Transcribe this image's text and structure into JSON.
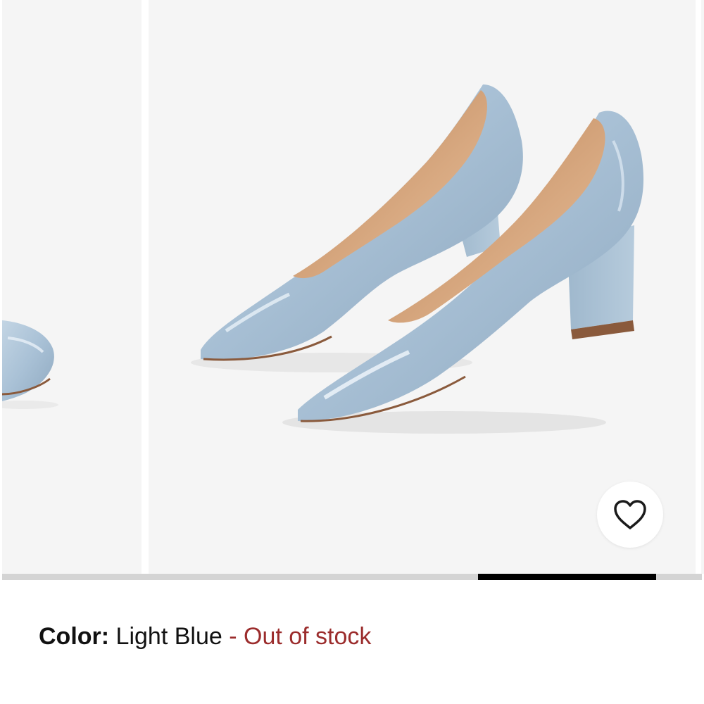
{
  "gallery": {
    "image_alt": "Light blue pointed-toe block heel pumps",
    "favorite_icon": "heart-outline-icon",
    "progress": {
      "start_fraction": 0.68,
      "end_fraction": 0.935
    }
  },
  "product": {
    "color_label": "Color:",
    "color_value": "Light Blue",
    "separator": " - ",
    "stock_status": "Out of stock"
  },
  "colors": {
    "shoe": "#a9c1d6",
    "lining": "#d2a27a",
    "stock_status": "#9b2c2c",
    "progress_thumb": "#000000",
    "progress_track": "#d4d4d4"
  }
}
